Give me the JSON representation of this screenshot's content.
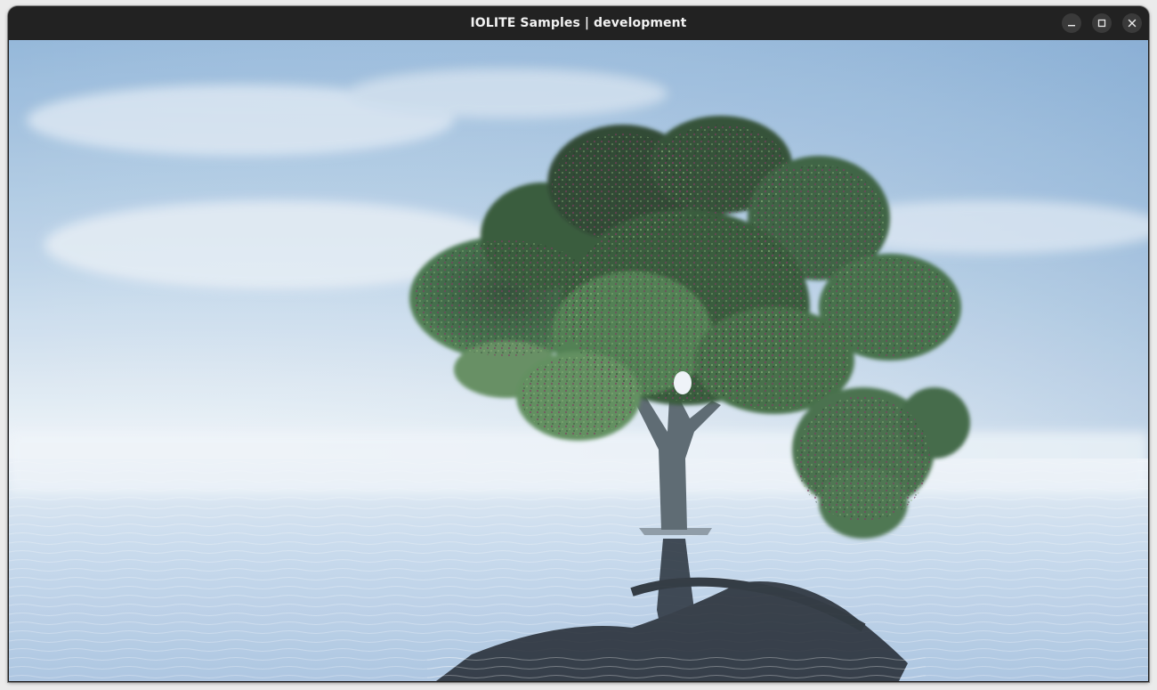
{
  "window": {
    "title": "IOLITE Samples | development",
    "controls": {
      "minimize_icon": "minimize-icon",
      "maximize_icon": "maximize-icon",
      "close_icon": "close-icon"
    }
  },
  "scene": {
    "sky_top": "#7fa8d1",
    "sky_horizon": "#e9f1f7",
    "water": "#b9cfe6",
    "foliage_dark": "#1f3d28",
    "foliage_mid": "#3f6b45",
    "foliage_light": "#6f9c63",
    "blossom": "#7a2e5a",
    "trunk": "#5d6a72"
  }
}
